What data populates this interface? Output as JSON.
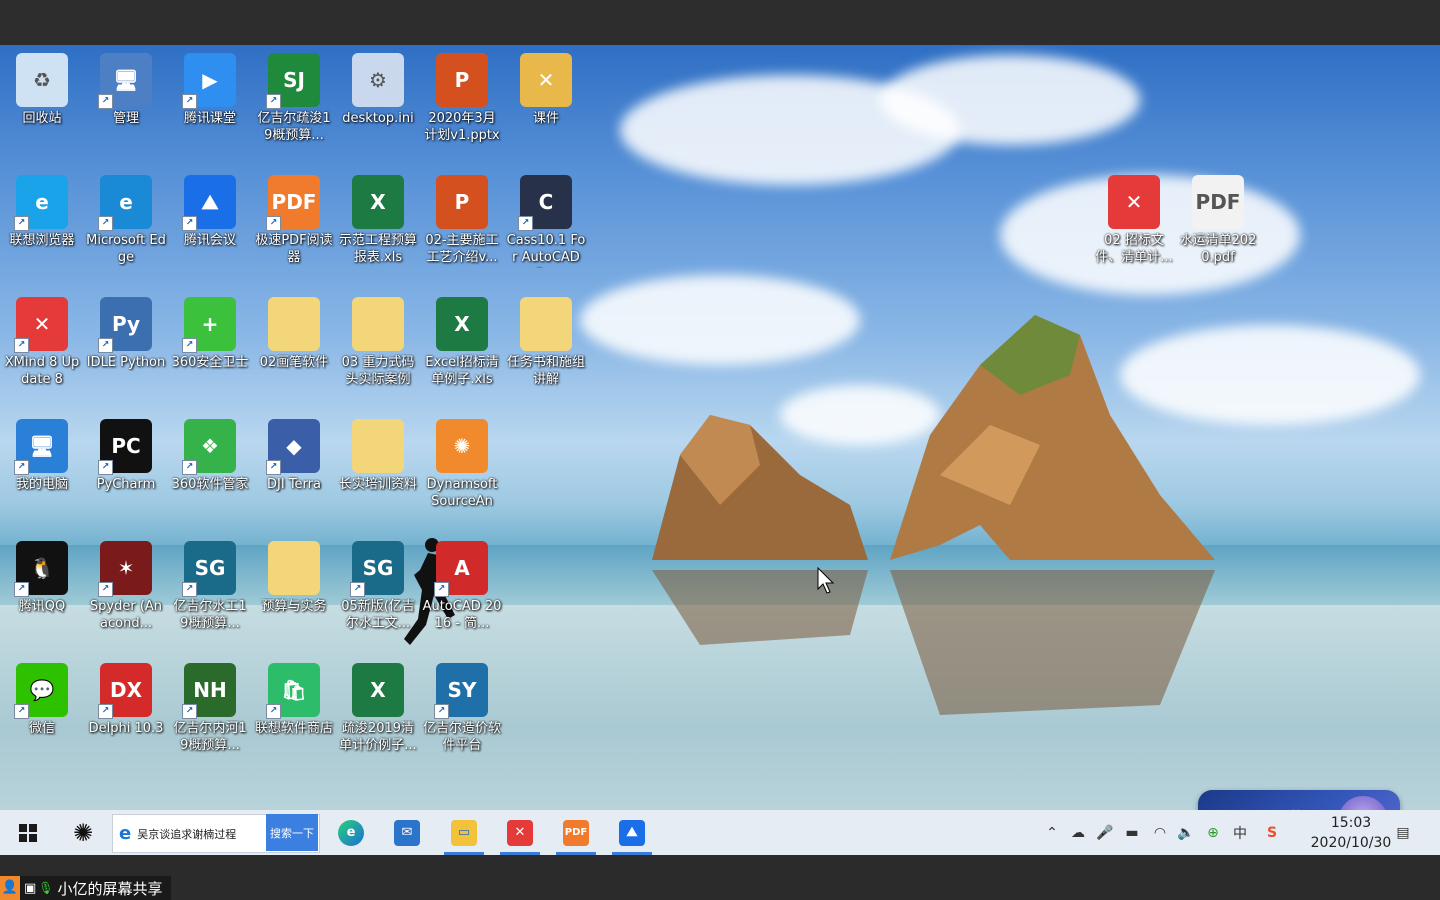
{
  "desktop": {
    "icons": [
      {
        "label": "回收站",
        "color": "#cfe2f3",
        "glyph": "♻",
        "shortcut": false
      },
      {
        "label": "管理",
        "color": "#4c7fc4",
        "glyph": "🖥",
        "shortcut": true
      },
      {
        "label": "腾讯课堂",
        "color": "#2f8ff0",
        "glyph": "▶",
        "shortcut": true
      },
      {
        "label": "亿吉尔疏浚19概预算...",
        "color": "#1f8a3c",
        "glyph": "SJ",
        "shortcut": true
      },
      {
        "label": "desktop.ini",
        "color": "#c9d8ec",
        "glyph": "⚙",
        "shortcut": false
      },
      {
        "label": "2020年3月计划v1.pptx",
        "color": "#d5501f",
        "glyph": "P",
        "shortcut": false
      },
      {
        "label": "课件",
        "color": "#e8b84a",
        "glyph": "✕",
        "shortcut": false
      },
      {
        "label": "联想浏览器",
        "color": "#1aa3e8",
        "glyph": "e",
        "shortcut": true
      },
      {
        "label": "Microsoft Edge",
        "color": "#1b8ad6",
        "glyph": "e",
        "shortcut": true
      },
      {
        "label": "腾讯会议",
        "color": "#1a6fe8",
        "glyph": "⛰",
        "shortcut": true
      },
      {
        "label": "极速PDF阅读器",
        "color": "#f07b2c",
        "glyph": "PDF",
        "shortcut": true
      },
      {
        "label": "示范工程预算报表.xls",
        "color": "#1d7a43",
        "glyph": "X",
        "shortcut": false
      },
      {
        "label": "02-主要施工工艺介绍v...",
        "color": "#d5501f",
        "glyph": "P",
        "shortcut": false
      },
      {
        "label": "Cass10.1 For AutoCAD2...",
        "color": "#27324a",
        "glyph": "C",
        "shortcut": true
      },
      {
        "label": "XMind 8 Update 8",
        "color": "#e43a3a",
        "glyph": "✕",
        "shortcut": true
      },
      {
        "label": "IDLE Python",
        "color": "#3c6fb0",
        "glyph": "Py",
        "shortcut": true
      },
      {
        "label": "360安全卫士",
        "color": "#3cc13c",
        "glyph": "+",
        "shortcut": true
      },
      {
        "label": "02画笔软件",
        "color": "#f3d57a",
        "glyph": "",
        "shortcut": false
      },
      {
        "label": "03 重力式码头实际案例",
        "color": "#f3d57a",
        "glyph": "",
        "shortcut": false
      },
      {
        "label": "Excel招标清单例子.xls",
        "color": "#1d7a43",
        "glyph": "X",
        "shortcut": false
      },
      {
        "label": "任务书和施组讲解",
        "color": "#f3d57a",
        "glyph": "",
        "shortcut": false
      },
      {
        "label": "我的电脑",
        "color": "#2a7fd6",
        "glyph": "🖥",
        "shortcut": true
      },
      {
        "label": "PyCharm",
        "color": "#111111",
        "glyph": "PC",
        "shortcut": true
      },
      {
        "label": "360软件管家",
        "color": "#35b34a",
        "glyph": "❖",
        "shortcut": true
      },
      {
        "label": "DJI Terra",
        "color": "#3a5fa8",
        "glyph": "◆",
        "shortcut": true
      },
      {
        "label": "长实培训资料",
        "color": "#f3d57a",
        "glyph": "",
        "shortcut": false
      },
      {
        "label": "Dynamsoft SourceAny...",
        "color": "#f08a2c",
        "glyph": "✺",
        "shortcut": false
      },
      {
        "label": "腾讯QQ",
        "color": "#111111",
        "glyph": "🐧",
        "shortcut": true
      },
      {
        "label": "Spyder (Anacond...",
        "color": "#7a1a1a",
        "glyph": "✶",
        "shortcut": true
      },
      {
        "label": "亿吉尔水工19概预算...",
        "color": "#1a6a8a",
        "glyph": "SG",
        "shortcut": true
      },
      {
        "label": "预算与实务",
        "color": "#f3d57a",
        "glyph": "",
        "shortcut": false
      },
      {
        "label": "05新版(亿吉尔水工文...",
        "color": "#1a6a8a",
        "glyph": "SG",
        "shortcut": true
      },
      {
        "label": "AutoCAD 2016 - 简...",
        "color": "#d02a2a",
        "glyph": "A",
        "shortcut": true
      },
      {
        "label": "微信",
        "color": "#2dc100",
        "glyph": "💬",
        "shortcut": true
      },
      {
        "label": "Delphi 10.3",
        "color": "#d42a2a",
        "glyph": "DX",
        "shortcut": true
      },
      {
        "label": "亿吉尔内河19概预算...",
        "color": "#2a6a2a",
        "glyph": "NH",
        "shortcut": true
      },
      {
        "label": "联想软件商店",
        "color": "#2dbd6a",
        "glyph": "🛍",
        "shortcut": true
      },
      {
        "label": "疏浚2019清单计价例子...",
        "color": "#1d7a43",
        "glyph": "X",
        "shortcut": false
      },
      {
        "label": "亿吉尔造价软件平台",
        "color": "#1f6fa8",
        "glyph": "SY",
        "shortcut": true
      },
      {
        "label": "02 招标文件、清单计...",
        "color": "#e43a3a",
        "glyph": "✕",
        "shortcut": false
      },
      {
        "label": "水运清单2020.pdf",
        "color": "#f2f2f2",
        "glyph": "PDF",
        "shortcut": false
      }
    ]
  },
  "taskbar": {
    "search_text": "吴京谈追求谢楠过程",
    "search_button": "搜索一下",
    "clock_time": "15:03",
    "clock_date": "2020/10/30",
    "ime_label": "中",
    "tray_ime": "中"
  },
  "ime_widget": {
    "label": "中"
  },
  "share": {
    "label": "小亿的屏幕共享"
  }
}
